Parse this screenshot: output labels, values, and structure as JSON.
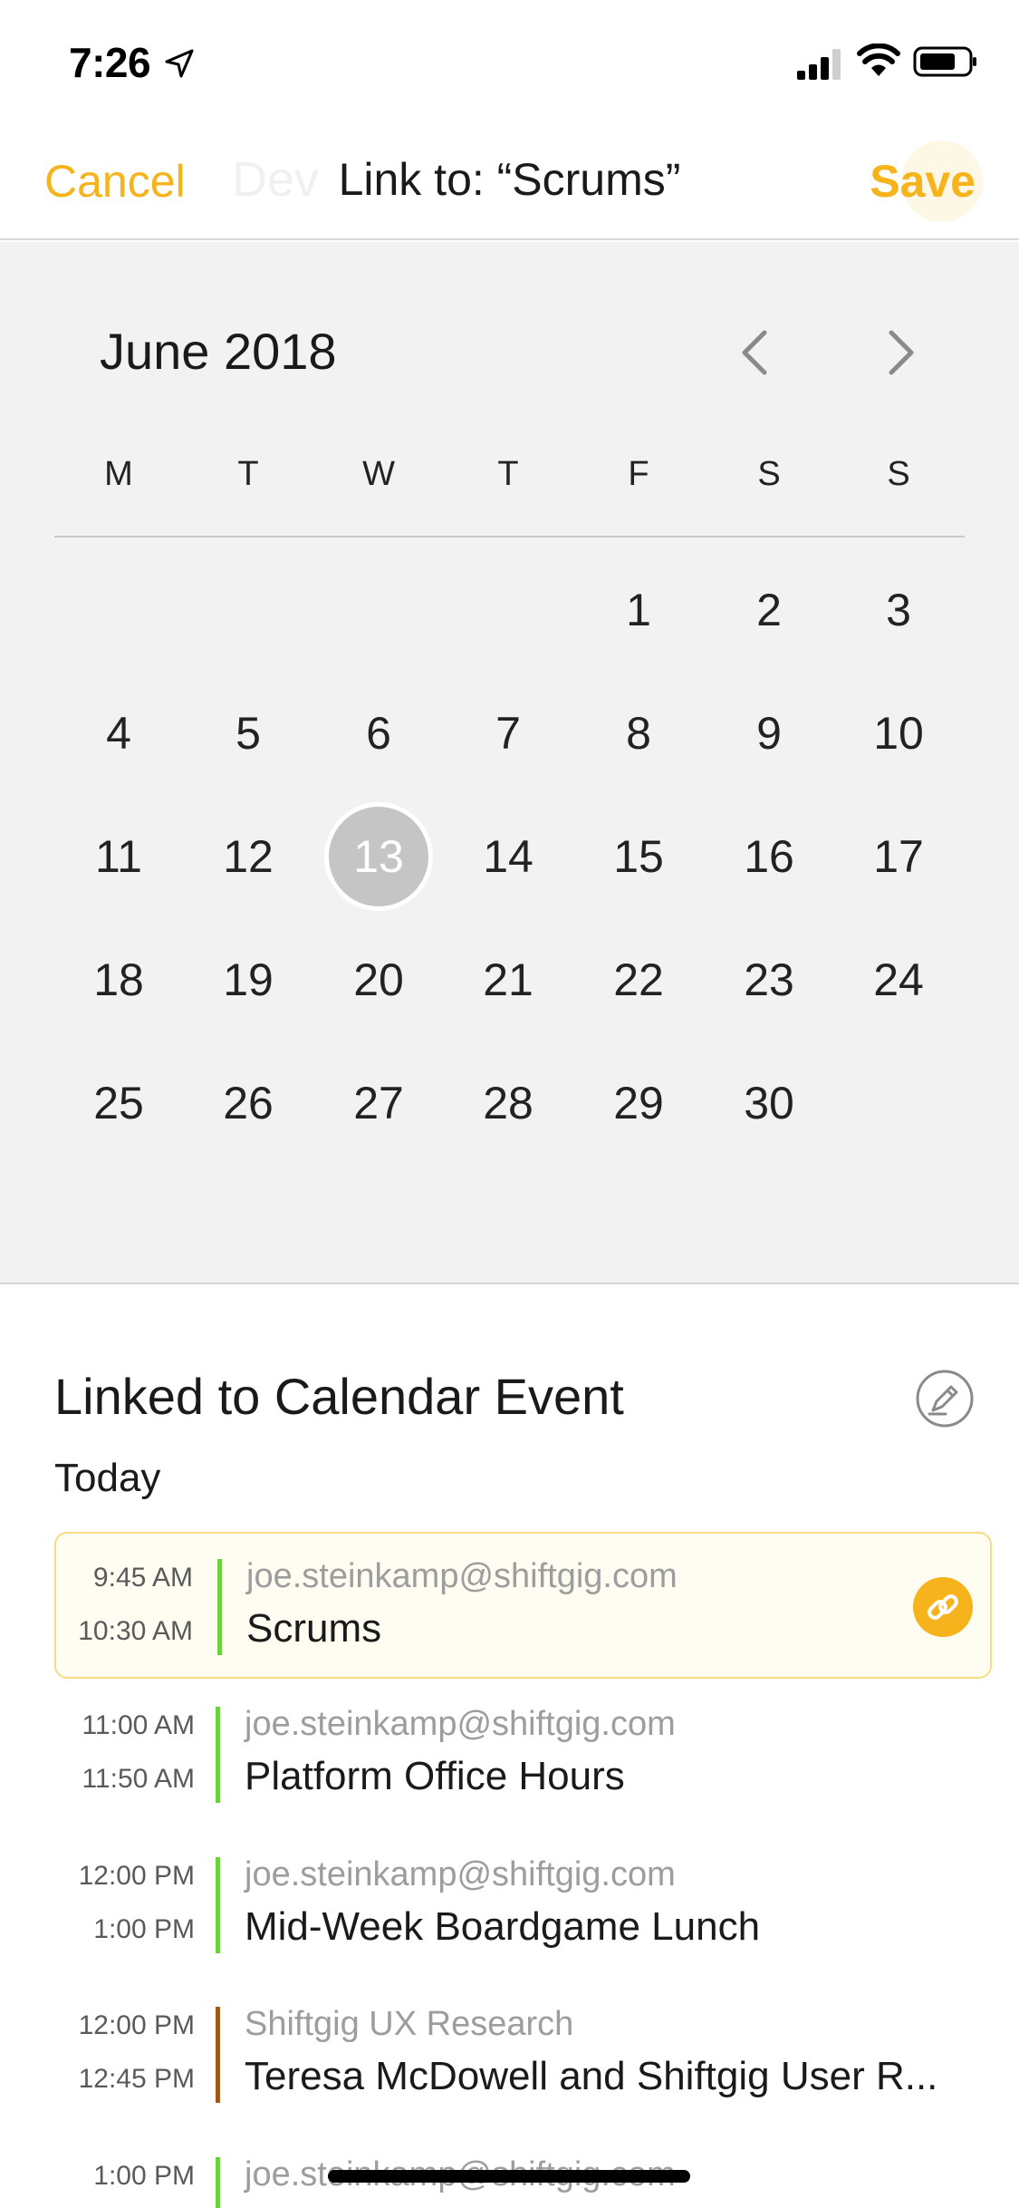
{
  "status_bar": {
    "time": "7:26",
    "icons": [
      "location-arrow-icon",
      "signal-icon",
      "wifi-icon",
      "battery-icon"
    ]
  },
  "nav": {
    "cancel_label": "Cancel",
    "title": "Link to: “Scrums”",
    "save_label": "Save",
    "background_text": "Dev"
  },
  "calendar": {
    "month_label": "June 2018",
    "weekdays": [
      "M",
      "T",
      "W",
      "T",
      "F",
      "S",
      "S"
    ],
    "first_weekday_index": 4,
    "days_in_month": 30,
    "selected_day": 13
  },
  "linked": {
    "title": "Linked to Calendar Event",
    "section_label": "Today",
    "events": [
      {
        "start": "9:45 AM",
        "end": "10:30 AM",
        "calendar": "joe.steinkamp@shiftgig.com",
        "title": "Scrums",
        "color": "#6ad33a",
        "linked": true
      },
      {
        "start": "11:00 AM",
        "end": "11:50 AM",
        "calendar": "joe.steinkamp@shiftgig.com",
        "title": "Platform Office Hours",
        "color": "#6ad33a",
        "linked": false
      },
      {
        "start": "12:00 PM",
        "end": "1:00 PM",
        "calendar": "joe.steinkamp@shiftgig.com",
        "title": "Mid-Week Boardgame Lunch",
        "color": "#6ad33a",
        "linked": false
      },
      {
        "start": "12:00 PM",
        "end": "12:45 PM",
        "calendar": "Shiftgig UX Research",
        "title": "Teresa McDowell and Shiftgig User R...",
        "color": "#a35a18",
        "linked": false
      },
      {
        "start": "1:00 PM",
        "end": "",
        "calendar": "joe.steinkamp@shiftgig.com",
        "title": "",
        "color": "#6ad33a",
        "linked": false
      }
    ]
  },
  "colors": {
    "accent": "#f6b31b",
    "calendar_bg": "#f2f2f2",
    "selected_day": "#c5c5c5"
  }
}
